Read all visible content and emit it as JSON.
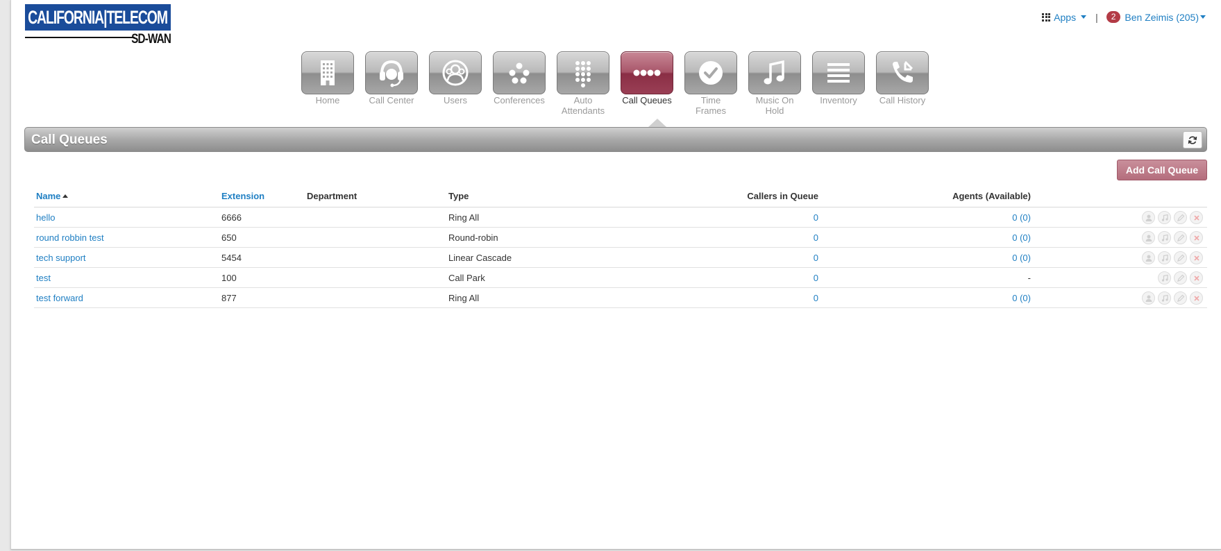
{
  "brand": {
    "logo_main": "CALIFORNIA|TELECOM",
    "logo_sub": "SD-WAN"
  },
  "topbar": {
    "apps_label": "Apps",
    "separator": "|",
    "notifications": "2",
    "user_label": "Ben Zeimis (205)"
  },
  "nav": [
    {
      "label": "Home",
      "icon": "building-icon"
    },
    {
      "label": "Call Center",
      "icon": "headset-icon"
    },
    {
      "label": "Users",
      "icon": "users-icon"
    },
    {
      "label": "Conferences",
      "icon": "conference-icon"
    },
    {
      "label": "Auto Attendants",
      "icon": "keypad-icon"
    },
    {
      "label": "Call Queues",
      "icon": "queue-dots-icon",
      "active": true
    },
    {
      "label": "Time Frames",
      "icon": "clock-icon"
    },
    {
      "label": "Music On Hold",
      "icon": "music-note-icon"
    },
    {
      "label": "Inventory",
      "icon": "list-icon"
    },
    {
      "label": "Call History",
      "icon": "phone-history-icon"
    }
  ],
  "section": {
    "title": "Call Queues",
    "add_button": "Add Call Queue"
  },
  "table": {
    "columns": {
      "name": "Name",
      "extension": "Extension",
      "department": "Department",
      "type": "Type",
      "callers": "Callers in Queue",
      "agents": "Agents (Available)"
    },
    "rows": [
      {
        "name": "hello",
        "extension": "6666",
        "department": "",
        "type": "Ring All",
        "callers": "0",
        "agents": "0 (0)"
      },
      {
        "name": "round robbin test",
        "extension": "650",
        "department": "",
        "type": "Round-robin",
        "callers": "0",
        "agents": "0 (0)"
      },
      {
        "name": "tech support",
        "extension": "5454",
        "department": "",
        "type": "Linear Cascade",
        "callers": "0",
        "agents": "0 (0)"
      },
      {
        "name": "test",
        "extension": "100",
        "department": "",
        "type": "Call Park",
        "callers": "0",
        "agents": "-"
      },
      {
        "name": "test forward",
        "extension": "877",
        "department": "",
        "type": "Ring All",
        "callers": "0",
        "agents": "0 (0)"
      }
    ]
  },
  "colors": {
    "accent": "#1f7fc3",
    "active_nav": "#8a2e45",
    "brand_blue": "#1a4c9a"
  }
}
